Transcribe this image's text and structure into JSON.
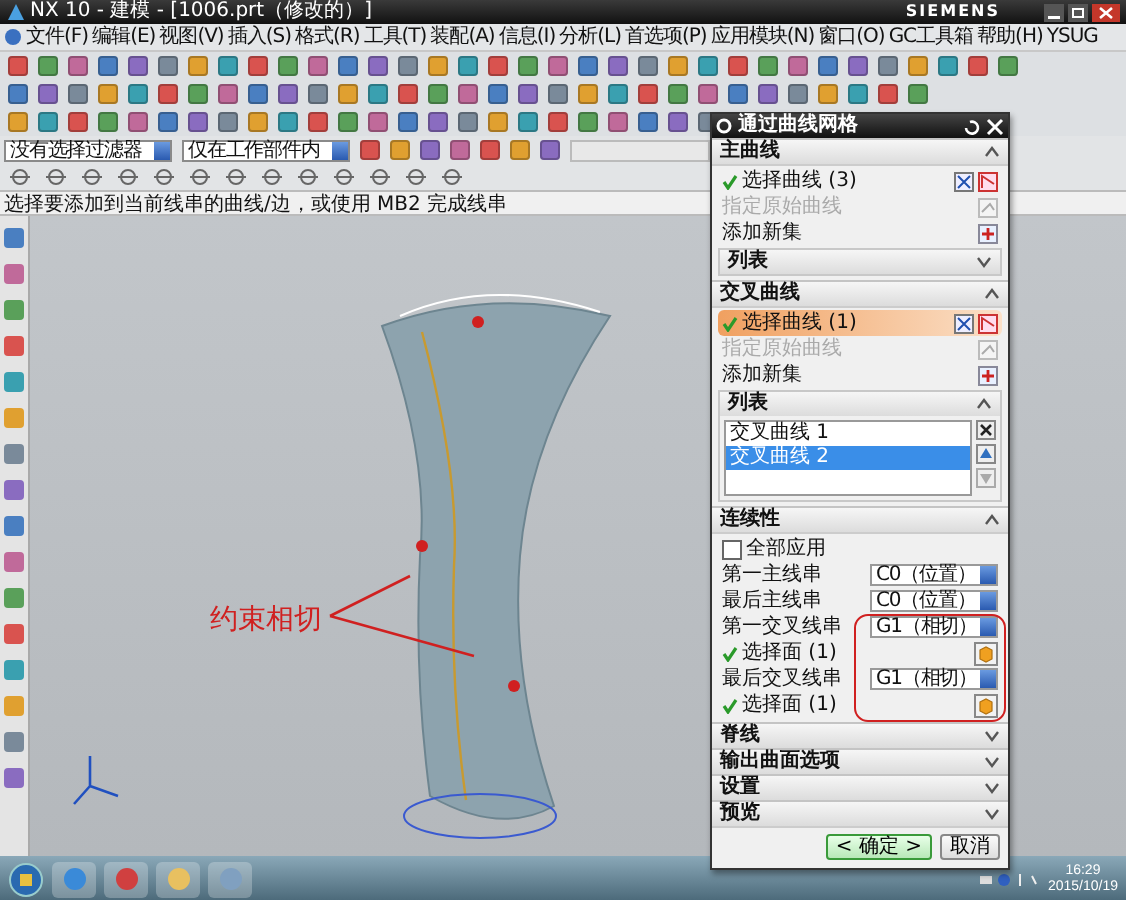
{
  "window": {
    "title": "NX 10 - 建模 - [1006.prt（修改的）]",
    "brand": "SIEMENS"
  },
  "menu": [
    "文件(F)",
    "编辑(E)",
    "视图(V)",
    "插入(S)",
    "格式(R)",
    "工具(T)",
    "装配(A)",
    "信息(I)",
    "分析(L)",
    "首选项(P)",
    "应用模块(N)",
    "窗口(O)",
    "GC工具箱",
    "帮助(H)",
    "YSUG"
  ],
  "selection_bar": {
    "filter": "没有选择过滤器",
    "scope": "仅在工作部件内"
  },
  "cue_line": "选择要添加到当前线串的曲线/边，或使用 MB2 完成线串",
  "annotation": "约束相切",
  "dialog": {
    "title": "通过曲线网格",
    "sections": [
      {
        "kind": "curves",
        "title": "主曲线",
        "expanded": true,
        "select": {
          "label": "选择曲线 (3)",
          "done": true,
          "active": false
        },
        "origin": {
          "label": "指定原始曲线",
          "disabled": true
        },
        "add": "添加新集",
        "list": {
          "title": "列表",
          "expanded": false
        }
      },
      {
        "kind": "curves",
        "title": "交叉曲线",
        "expanded": true,
        "select": {
          "label": "选择曲线 (1)",
          "done": true,
          "active": true
        },
        "origin": {
          "label": "指定原始曲线",
          "disabled": true
        },
        "add": "添加新集",
        "list": {
          "title": "列表",
          "expanded": true,
          "items": [
            {
              "label": "交叉曲线 1",
              "selected": false
            },
            {
              "label": "交叉曲线 2",
              "selected": true
            }
          ]
        }
      },
      {
        "kind": "continuity",
        "title": "连续性",
        "expanded": true,
        "apply_all": {
          "label": "全部应用",
          "checked": false
        },
        "rows": [
          {
            "kind": "dropdown",
            "label": "第一主线串",
            "value": "C0（位置）"
          },
          {
            "kind": "dropdown",
            "label": "最后主线串",
            "value": "C0（位置）"
          },
          {
            "kind": "dropdown",
            "label": "第一交叉线串",
            "value": "G1（相切）"
          },
          {
            "kind": "face",
            "label": "选择面 (1)",
            "done": true
          },
          {
            "kind": "dropdown",
            "label": "最后交叉线串",
            "value": "G1（相切）"
          },
          {
            "kind": "face",
            "label": "选择面 (1)",
            "done": true
          }
        ]
      },
      {
        "title": "脊线",
        "expanded": false
      },
      {
        "title": "输出曲面选项",
        "expanded": false
      },
      {
        "title": "设置",
        "expanded": false
      },
      {
        "title": "预览",
        "expanded": false
      }
    ],
    "buttons": [
      {
        "label": "< 确定 >",
        "default": true
      },
      {
        "label": "取消",
        "default": false
      }
    ]
  },
  "taskbar": {
    "time": "16:29",
    "date": "2015/10/19"
  }
}
